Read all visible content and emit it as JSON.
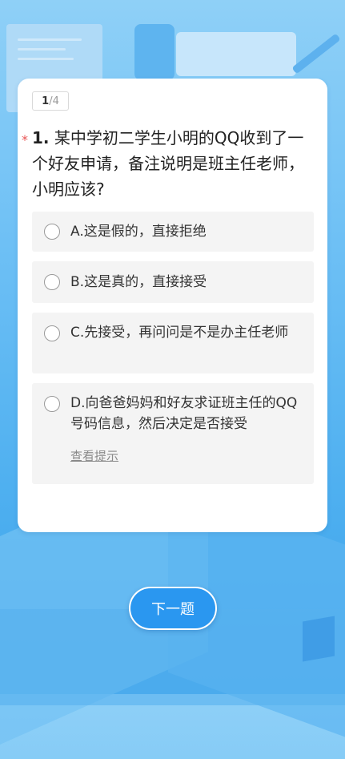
{
  "progress": {
    "current": "1",
    "total": "/4"
  },
  "question": {
    "required_mark": "*",
    "number": "1.",
    "text": " 某中学初二学生小明的QQ收到了一个好友申请，备注说明是班主任老师，小明应该?"
  },
  "options": [
    {
      "label": "A.这是假的，直接拒绝"
    },
    {
      "label": "B.这是真的，直接接受"
    },
    {
      "label": "C.先接受，再问问是不是办主任老师"
    },
    {
      "label": "D.向爸爸妈妈和好友求证班主任的QQ号码信息，然后决定是否接受"
    }
  ],
  "hint_link": "查看提示",
  "next_button": "下一题"
}
